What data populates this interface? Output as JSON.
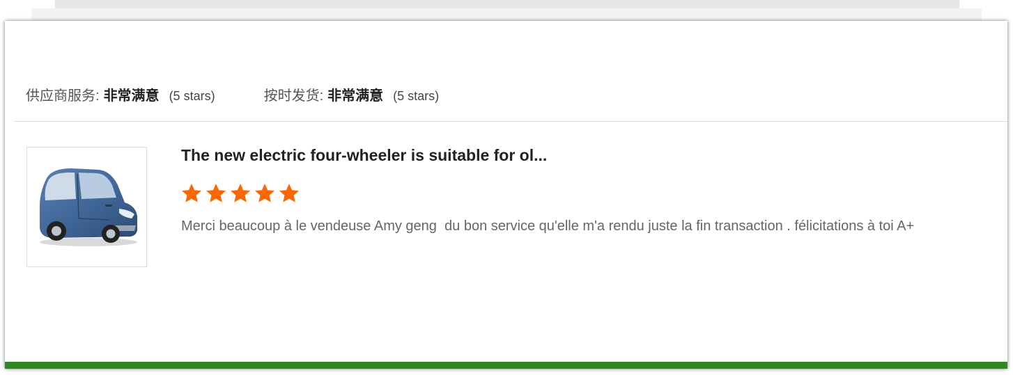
{
  "ratings": [
    {
      "label": "供应商服务:",
      "value": "非常满意",
      "stars_text": "(5 stars)"
    },
    {
      "label": "按时发货:",
      "value": "非常满意",
      "stars_text": "(5 stars)"
    }
  ],
  "review": {
    "product_title": "The new electric four-wheeler is suitable for ol...",
    "rating": 5,
    "rating_max": 5,
    "text": "Merci beaucoup à le vendeuse Amy geng  du bon service qu'elle m'a rendu juste la fin transaction . félicitations à toi A+",
    "thumbnail_icon": "blue-electric-car-image"
  },
  "colors": {
    "star": "#ff6600",
    "bottom_bar": "#2b8a22",
    "divider": "#dddddd"
  }
}
